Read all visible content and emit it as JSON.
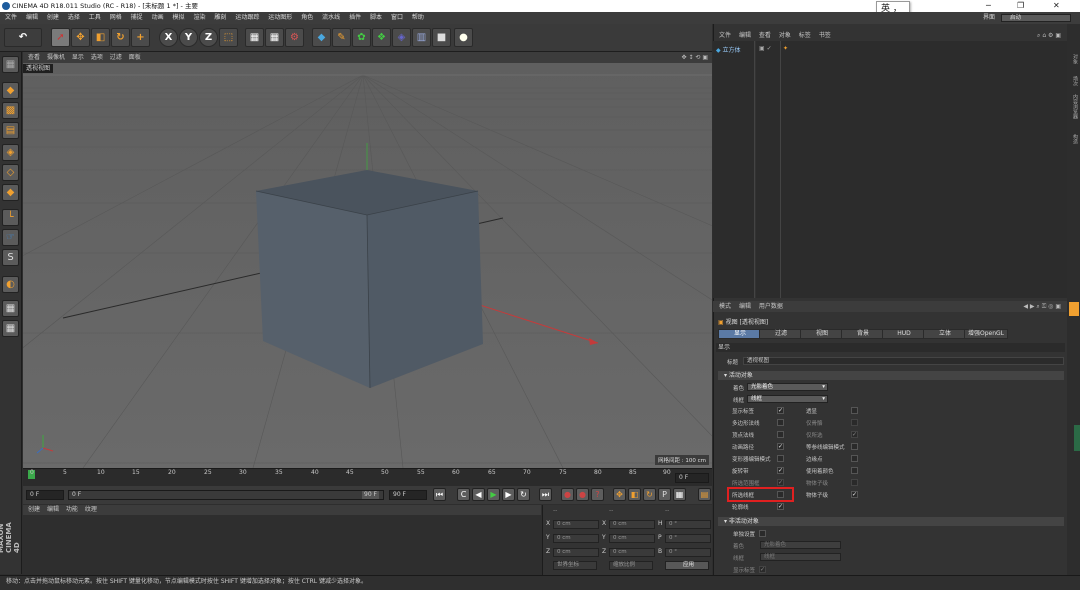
{
  "window": {
    "title": "CINEMA 4D R18.011 Studio (RC - R18) - [未标题 1 *] - 主要",
    "minimize": "─",
    "maximize": "❐",
    "close": "✕"
  },
  "ime": {
    "text": "英 ，"
  },
  "menu": {
    "items": [
      "文件",
      "编辑",
      "创建",
      "选择",
      "工具",
      "网格",
      "捕捉",
      "动画",
      "模拟",
      "渲染",
      "雕刻",
      "运动跟踪",
      "运动图形",
      "角色",
      "流水线",
      "插件",
      "脚本",
      "窗口",
      "帮助"
    ],
    "layout_label": "界面",
    "layout_value": "启动"
  },
  "toolbar": {
    "icons": [
      "undo-icon",
      "redo-icon",
      "select-icon",
      "move-icon",
      "scale-icon",
      "rotate-icon",
      "add-icon",
      "x-axis-icon",
      "y-axis-icon",
      "z-axis-icon",
      "world-coord-icon",
      "render-view-icon",
      "render-picture-viewer-icon",
      "render-settings-icon",
      "cube-icon",
      "pen-icon",
      "subdivision-icon",
      "cloner-icon",
      "deformer-icon",
      "floor-icon",
      "camera-icon",
      "light-icon"
    ],
    "axis_x": "X",
    "axis_y": "Y",
    "axis_z": "Z"
  },
  "viewport": {
    "menu": [
      "查看",
      "摄像机",
      "显示",
      "选项",
      "过滤",
      "面板"
    ],
    "tag": "透视视图",
    "footer": "网格间距 : 100 cm"
  },
  "timeline": {
    "ticks": [
      "0",
      "5",
      "10",
      "15",
      "20",
      "25",
      "30",
      "35",
      "40",
      "45",
      "50",
      "55",
      "60",
      "65",
      "70",
      "75",
      "80",
      "85",
      "90"
    ],
    "end_field": "0 F"
  },
  "transport": {
    "start": "0 F",
    "slider_start": "0 F",
    "slider_end": "90 F",
    "end": "90 F"
  },
  "material_manager": {
    "menu": [
      "创建",
      "编辑",
      "功能",
      "纹理"
    ]
  },
  "maxon": "MAXON CINEMA 4D",
  "coords": {
    "header": [
      "--",
      "--",
      "--"
    ],
    "rows": [
      {
        "a": "X",
        "av": "0 cm",
        "b": "X",
        "bv": "0 cm",
        "c": "H",
        "cv": "0 °"
      },
      {
        "a": "Y",
        "av": "0 cm",
        "b": "Y",
        "bv": "0 cm",
        "c": "P",
        "cv": "0 °"
      },
      {
        "a": "Z",
        "av": "0 cm",
        "b": "Z",
        "bv": "0 cm",
        "c": "B",
        "cv": "0 °"
      }
    ],
    "mode1": "世界坐标",
    "mode2": "缩放比例",
    "apply": "应用"
  },
  "object_manager": {
    "menu": [
      "文件",
      "编辑",
      "查看",
      "对象",
      "标签",
      "书签"
    ],
    "object_name": "立方体"
  },
  "right_vtabs": [
    "对象",
    "场次",
    "内容浏览器",
    "构造"
  ],
  "attributes": {
    "menu": [
      "模式",
      "编辑",
      "用户数据"
    ],
    "title": "视图 [透视视图]",
    "tabs": [
      "显示",
      "过滤",
      "视图",
      "背景",
      "HUD",
      "立体",
      "增强OpenGL"
    ],
    "display_label": "显示",
    "title_field_label": "标题",
    "title_field_value": "透视视图",
    "active_section": "活动对象",
    "shading_label": "着色",
    "shading_value": "光影着色",
    "wire_label": "线框",
    "wire_value": "线框",
    "left_opts": [
      {
        "label": "显示标签",
        "checked": "✓",
        "dim": false
      },
      {
        "label": "多边形法线",
        "checked": "",
        "dim": false
      },
      {
        "label": "顶点法线",
        "checked": "",
        "dim": false
      },
      {
        "label": "动画路径",
        "checked": "✓",
        "dim": false
      },
      {
        "label": "变形器编辑模式",
        "checked": "",
        "dim": false
      },
      {
        "label": "旋转带",
        "checked": "✓",
        "dim": false
      },
      {
        "label": "所选范围框",
        "checked": "✓",
        "dim": true
      },
      {
        "label": "所选线框",
        "checked": "",
        "dim": false
      },
      {
        "label": "轮廓线",
        "checked": "✓",
        "dim": false
      }
    ],
    "right_opts": [
      {
        "label": "透显",
        "checked": "",
        "dim": false
      },
      {
        "label": "仅骨骼",
        "checked": "",
        "dim": true
      },
      {
        "label": "仅所选",
        "checked": "✓",
        "dim": true
      },
      {
        "label": "等参线编辑模式",
        "checked": "",
        "dim": false
      },
      {
        "label": "边缘点",
        "checked": "",
        "dim": false
      },
      {
        "label": "使用着颜色",
        "checked": "",
        "dim": false
      },
      {
        "label": "物体子级",
        "checked": "",
        "dim": true
      },
      {
        "label": "物体子级",
        "checked": "✓",
        "dim": false
      }
    ],
    "inactive_section": "非活动对象",
    "single_color_label": "单独设置",
    "inactive_shading_label": "着色",
    "inactive_shading_value": "光影着色",
    "inactive_wire_label": "线框",
    "inactive_wire_value": "线框",
    "show_tags_label": "显示标签",
    "show_tags_checked": "✓"
  },
  "status": {
    "text": "移动：点击并拖动鼠标移动元素。按住 SHIFT 键量化移动，节点编辑模式时按住 SHIFT 键增加选择对象；按住 CTRL 键减少选择对象。"
  }
}
